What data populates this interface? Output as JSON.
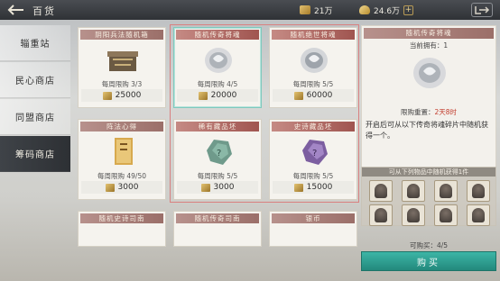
{
  "header": {
    "title": "百货",
    "currency1": "21万",
    "currency2": "24.6万",
    "add": "+"
  },
  "sidebar": {
    "items": [
      {
        "label": "辎重站"
      },
      {
        "label": "民心商店"
      },
      {
        "label": "同盟商店"
      },
      {
        "label": "筹码商店"
      }
    ]
  },
  "cards": [
    {
      "title": "阴阳兵法随机箱",
      "limit": "每周限购 3/3",
      "price": "25000"
    },
    {
      "title": "随机传奇将魂",
      "limit": "每周限购 4/5",
      "price": "20000"
    },
    {
      "title": "随机绝世将魂",
      "limit": "每周限购 5/5",
      "price": "60000"
    },
    {
      "title": "阵法心得",
      "limit": "每周限购 49/50",
      "price": "3000"
    },
    {
      "title": "稀有藏品坯",
      "limit": "每周限购 5/5",
      "price": "3000"
    },
    {
      "title": "史诗藏品坯",
      "limit": "每周限购 5/5",
      "price": "15000"
    },
    {
      "title": "随机史诗司南"
    },
    {
      "title": "随机传奇司南"
    },
    {
      "title": "银币"
    }
  ],
  "detail": {
    "title": "随机传奇将魂",
    "owned": "当前拥有：1",
    "restock_label": "限购重置：",
    "restock_time": "2天8时",
    "desc": "开启后可从以下传奇将魂碎片中随机获得一个。"
  },
  "pool": {
    "title": "可从下列物品中随机获得1件"
  },
  "purchase": {
    "can_buy": "可购买：4/5",
    "button": "购买"
  },
  "colors": {
    "accent": "#2ea597",
    "card_header": "#a87a74",
    "highlight": "#7fc9bd"
  }
}
